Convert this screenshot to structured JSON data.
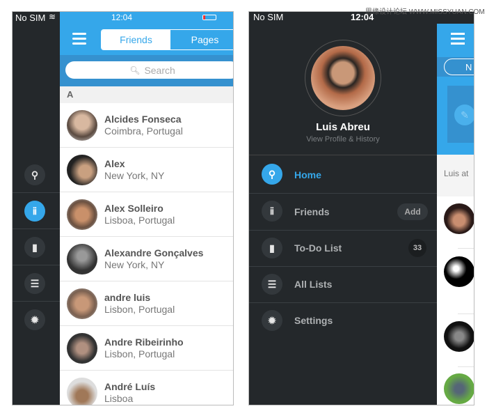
{
  "left_screen": {
    "status": {
      "carrier": "No SIM",
      "time": "12:04"
    },
    "tabs": [
      {
        "label": "Friends",
        "active": true
      },
      {
        "label": "Pages",
        "active": false
      }
    ],
    "search_placeholder": "Search",
    "section_letter": "A",
    "contacts": [
      {
        "name": "Alcides Fonseca",
        "location": "Coimbra, Portugal"
      },
      {
        "name": "Alex",
        "location": "New York, NY"
      },
      {
        "name": "Alex Solleiro",
        "location": "Lisboa, Portugal"
      },
      {
        "name": "Alexandre Gonçalves",
        "location": "New York, NY"
      },
      {
        "name": "andre luis",
        "location": "Lisbon, Portugal"
      },
      {
        "name": "Andre Ribeirinho",
        "location": "Lisbon, Portugal"
      },
      {
        "name": "André Luís",
        "location": "Lisboa"
      }
    ],
    "sidebar_icons": [
      "location-pin-icon",
      "friends-icon",
      "bookmark-icon",
      "list-icon",
      "gear-icon"
    ],
    "sidebar_active": 1
  },
  "right_screen": {
    "status": {
      "carrier": "No SIM",
      "time": "12:04"
    },
    "profile": {
      "name": "Luis Abreu",
      "subtitle": "View Profile & History"
    },
    "menu": [
      {
        "label": "Home",
        "icon": "location-pin-icon",
        "active": true
      },
      {
        "label": "Friends",
        "icon": "friends-icon",
        "badge": "Add"
      },
      {
        "label": "To-Do List",
        "icon": "bookmark-icon",
        "badge": "33"
      },
      {
        "label": "All Lists",
        "icon": "list-icon"
      },
      {
        "label": "Settings",
        "icon": "gear-icon"
      }
    ],
    "peek": {
      "pill_text": "N",
      "feed_text": "Luis at"
    }
  },
  "watermark": "思缘设计论坛 WWW.MISSYUAN.COM",
  "colors": {
    "accent": "#35a7ea",
    "sidebar": "#24282b"
  }
}
